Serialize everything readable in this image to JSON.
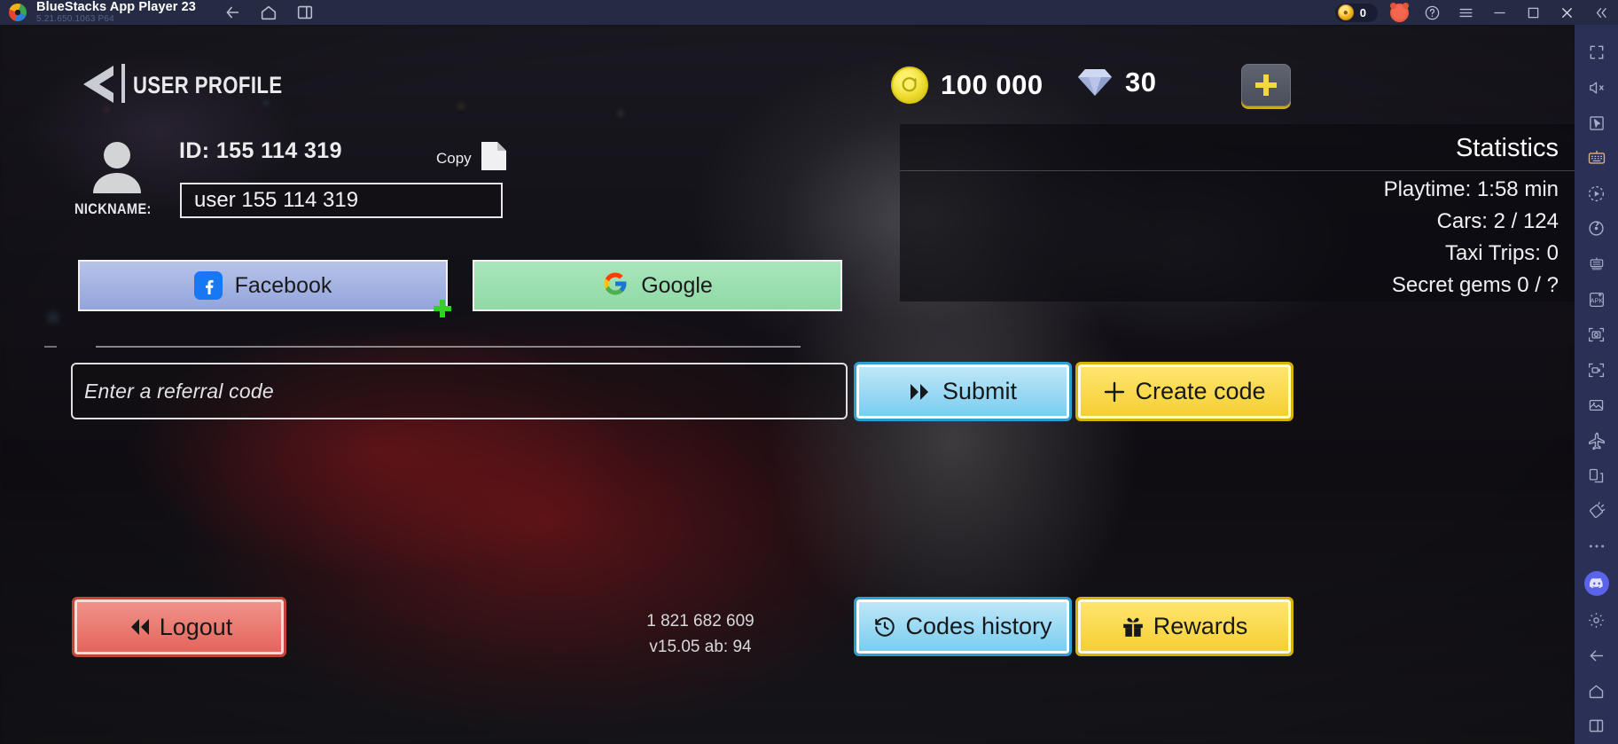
{
  "window": {
    "app_title": "BlueStacks App Player 23",
    "app_version": "5.21.650.1063  P64",
    "logo_icon": "bluestacks-logo-icon",
    "nav": [
      {
        "name": "back",
        "icon": "arrow-left-icon"
      },
      {
        "name": "home",
        "icon": "home-icon"
      },
      {
        "name": "multi-instance",
        "icon": "windows-stack-icon"
      }
    ],
    "points_pill": {
      "icon": "bluestacks-coin-icon",
      "value": "0"
    },
    "mascot_icon": "bear-mascot-icon",
    "help_icon": "help-circle-icon",
    "menu_icon": "hamburger-menu-icon",
    "minimize_icon": "minimize-icon",
    "maximize_icon": "maximize-icon",
    "close_icon": "close-icon",
    "collapse_icon": "chevron-double-left-icon"
  },
  "sidebar": {
    "items": [
      {
        "name": "fullscreen",
        "icon": "fullscreen-icon",
        "active": false
      },
      {
        "name": "mute",
        "icon": "speaker-mute-icon",
        "active": false
      },
      {
        "name": "pointer-mode",
        "icon": "cursor-pointer-icon",
        "active": false
      },
      {
        "name": "game-controls",
        "icon": "keyboard-icon",
        "active": true
      },
      {
        "name": "macro-recorder",
        "icon": "macro-play-icon",
        "active": false
      },
      {
        "name": "rotate",
        "icon": "rotate-icon",
        "active": false
      },
      {
        "name": "script",
        "icon": "script-icon",
        "active": false
      },
      {
        "name": "install-apk",
        "icon": "apk-install-icon",
        "active": false
      },
      {
        "name": "screenshot",
        "icon": "camera-icon",
        "active": false
      },
      {
        "name": "record-video",
        "icon": "video-record-icon",
        "active": false
      },
      {
        "name": "media-manager",
        "icon": "image-gallery-icon",
        "active": false
      },
      {
        "name": "eco-mode",
        "icon": "airplane-icon",
        "active": false
      },
      {
        "name": "multi-instance",
        "icon": "copy-windows-icon",
        "active": false
      },
      {
        "name": "shake",
        "icon": "shake-device-icon",
        "active": false
      },
      {
        "name": "more-options",
        "icon": "ellipsis-icon",
        "active": false
      },
      {
        "name": "discord",
        "icon": "discord-icon",
        "active": false
      },
      {
        "name": "settings",
        "icon": "gear-icon",
        "active": false
      },
      {
        "name": "back",
        "icon": "arrow-left-icon",
        "active": false
      },
      {
        "name": "home",
        "icon": "home-icon",
        "active": false
      },
      {
        "name": "recents",
        "icon": "recents-icon",
        "active": false
      }
    ]
  },
  "game": {
    "header": {
      "back_icon": "back-arrow-icon",
      "title": "USER PROFILE",
      "coins": {
        "icon": "coin-icon",
        "value": "100 000"
      },
      "gems": {
        "icon": "gem-icon",
        "value": "30"
      },
      "add_button": {
        "icon": "plus-icon",
        "label": ""
      }
    },
    "profile": {
      "avatar_icon": "user-avatar-icon",
      "id_text": "ID: 155 114 319",
      "copy_label": "Copy",
      "copy_icon": "copy-icon",
      "nickname_label": "NICKNAME:",
      "nickname_value": "user 155 114 319"
    },
    "statistics": {
      "title": "Statistics",
      "rows": [
        "Playtime: 1:58 min",
        "Cars: 2 / 124",
        "Taxi Trips: 0",
        "Secret gems 0 / ?"
      ]
    },
    "social": {
      "facebook": {
        "label": "Facebook",
        "icon": "facebook-icon",
        "color": "#9bacdf"
      },
      "google": {
        "label": "Google",
        "icon": "google-icon",
        "color": "#96dcac"
      }
    },
    "referral": {
      "placeholder": "Enter a referral code",
      "value": "",
      "submit": {
        "label": "Submit",
        "icon": "double-chevron-right-icon",
        "color": "#79cdf0"
      },
      "create": {
        "label": "Create code",
        "icon": "plus-thin-icon",
        "color": "#f5cf33"
      }
    },
    "footer": {
      "logout": {
        "label": "Logout",
        "icon": "double-chevron-left-icon",
        "color": "#e4655c"
      },
      "build_number": "1 821 682 609",
      "build_version": "v15.05 ab: 94",
      "codes_history": {
        "label": "Codes history",
        "icon": "history-clock-icon",
        "color": "#79cdf0"
      },
      "rewards": {
        "label": "Rewards",
        "icon": "gift-icon",
        "color": "#f5cf33"
      }
    },
    "cursor_icon": "green-crosshair-cursor-icon"
  }
}
